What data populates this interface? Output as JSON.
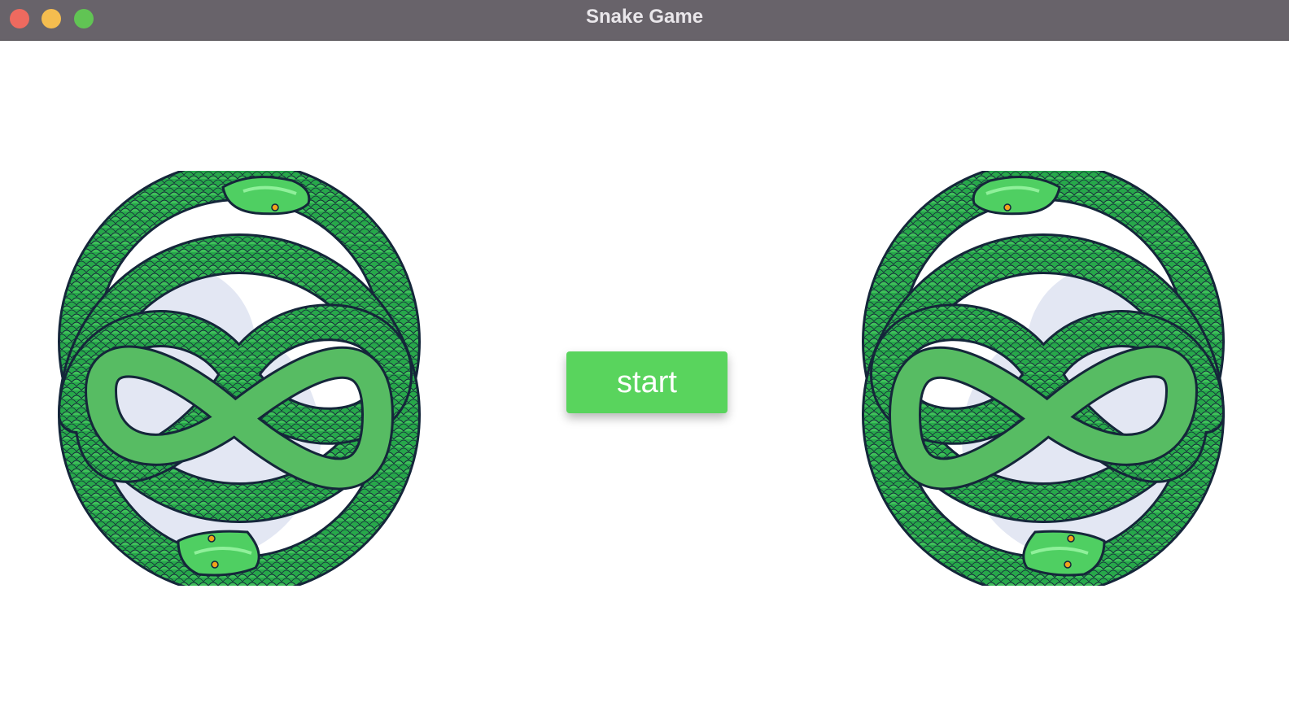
{
  "window": {
    "title": "Snake Game",
    "controls": [
      "close",
      "minimize",
      "zoom"
    ]
  },
  "colors": {
    "titlebar": "#68636a",
    "title_text": "#e9e6ea",
    "close": "#ee6a5f",
    "minimize": "#f5bd4f",
    "zoom": "#61c454",
    "button": "#59d45d",
    "button_text": "#ffffff",
    "snake_body": "#27a84a",
    "snake_outline": "#15263a",
    "snake_light": "#63d76b",
    "backdrop": "#e3e7f3"
  },
  "main": {
    "start_label": "start"
  },
  "emblems": [
    {
      "icon": "ouroboros-snakes-icon"
    },
    {
      "icon": "ouroboros-snakes-icon"
    }
  ]
}
